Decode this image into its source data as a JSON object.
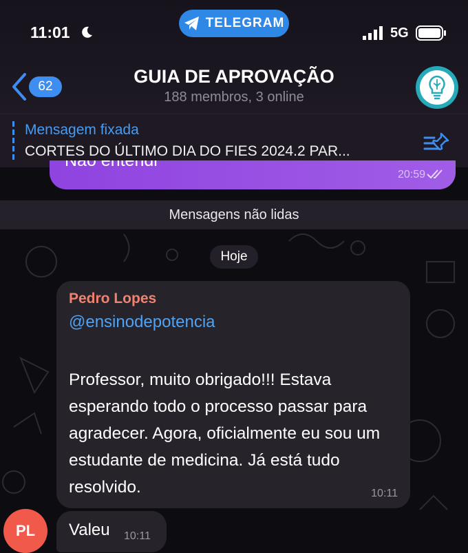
{
  "status": {
    "time": "11:01",
    "network": "5G",
    "app_pill": "TELEGRAM"
  },
  "header": {
    "back_count": "62",
    "title": "GUIA DE APROVAÇÃO",
    "subtitle": "188 membros, 3 online"
  },
  "pinned": {
    "label": "Mensagem fixada",
    "text": "CORTES DO ÚLTIMO DIA DO FIES 2024.2 PAR..."
  },
  "previous_message": {
    "text": "Não entendi",
    "time": "20:59"
  },
  "separators": {
    "unread": "Mensagens não lidas",
    "date": "Hoje"
  },
  "messages": [
    {
      "sender": "Pedro Lopes",
      "mention": "@ensinodepotencia",
      "text": "Professor, muito obrigado!!! Estava esperando todo o processo passar para agradecer. Agora, oficialmente eu sou um estudante de medicina. Já está tudo resolvido.",
      "time": "10:11"
    },
    {
      "avatar_initials": "PL",
      "text": "Valeu",
      "time": "10:11"
    }
  ],
  "colors": {
    "accent": "#3d8ef0",
    "sender": "#f0826f",
    "own_bubble": "#9a4fe4",
    "avatar": "#f15a4a",
    "group_avatar": "#26a9b8"
  }
}
